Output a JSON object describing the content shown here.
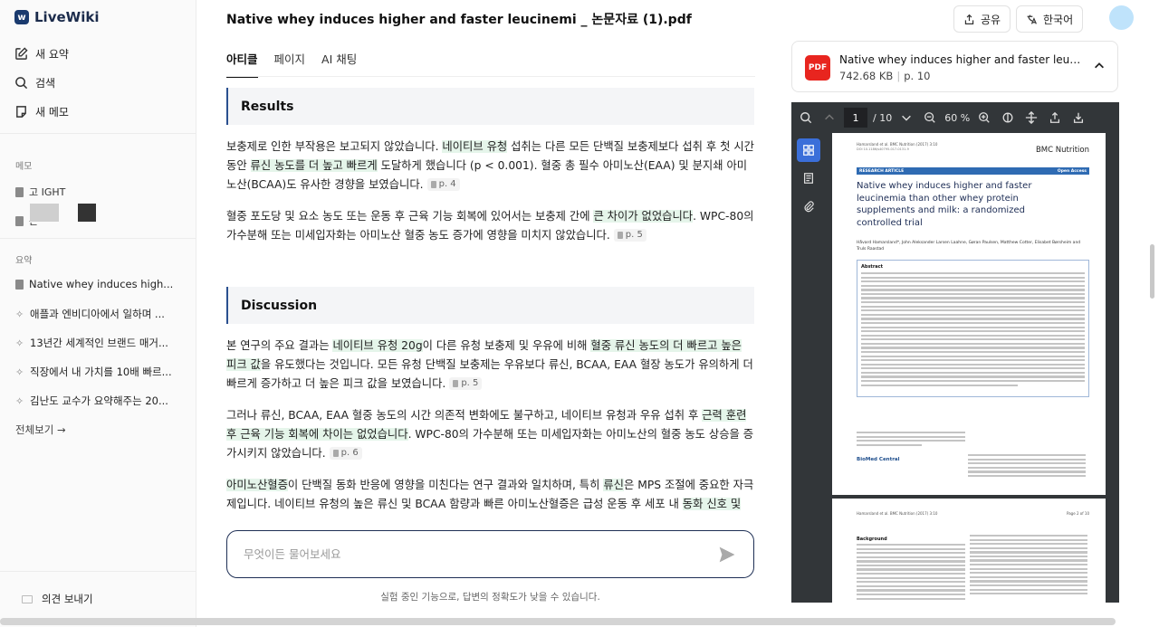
{
  "app": {
    "name": "LiveWiki"
  },
  "sidebar": {
    "nav": [
      {
        "label": "새 요약"
      },
      {
        "label": "검색"
      },
      {
        "label": "새 메모"
      }
    ],
    "memo_section": "메모",
    "memos": [
      {
        "label": "고                    IGHT"
      },
      {
        "label": "는"
      }
    ],
    "summary_section": "요약",
    "summaries": [
      {
        "label": "Native whey induces high..."
      },
      {
        "label": "애플과 엔비디아에서 일하며 ..."
      },
      {
        "label": "13년간 세계적인 브랜드 매거..."
      },
      {
        "label": "직장에서 내 가치를 10배 빠르..."
      },
      {
        "label": "김난도 교수가 요약해주는 20..."
      }
    ],
    "view_all": "전체보기 →",
    "feedback": "의견 보내기"
  },
  "main": {
    "title": "Native whey induces higher and faster leucinemi _ 논문자료 (1).pdf",
    "tabs": [
      {
        "label": "아티클",
        "active": true
      },
      {
        "label": "페이지"
      },
      {
        "label": "AI 채팅"
      }
    ],
    "sections": [
      {
        "heading": "Results",
        "paragraphs": [
          {
            "parts": [
              {
                "t": "보충제로 인한 부작용은 보고되지 않았습니다. "
              },
              {
                "t": "네이티브 유청",
                "hl": true
              },
              {
                "t": " 섭취는 다른 모든 단백질 보충제보다 섭취 후 첫 시간 동안 "
              },
              {
                "t": "류신 농도를 더 높고 빠르게",
                "hl": true
              },
              {
                "t": " 도달하게 했습니다 (p < 0.001). 혈중 총 필수 아미노산(EAA) 및 분지쇄 아미노산(BCAA)도 유사한 경향을 보였습니다."
              }
            ],
            "page": "p. 4"
          },
          {
            "parts": [
              {
                "t": "혈중 포도당 및 요소 농도 또는 운동 후 근육 기능 회복에 있어서는 보충제 간에 "
              },
              {
                "t": "큰 차이가 없었습니다",
                "hl": true
              },
              {
                "t": ". WPC-80의 가수분해 또는 미세입자화는 아미노산 혈중 농도 증가에 영향을 미치지 않았습니다."
              }
            ],
            "page": "p. 5"
          }
        ]
      },
      {
        "heading": "Discussion",
        "paragraphs": [
          {
            "parts": [
              {
                "t": "본 연구의 주요 결과는 "
              },
              {
                "t": "네이티브 유청 20g",
                "hl": true
              },
              {
                "t": "이 다른 유청 보충제 및 우유에 비해 "
              },
              {
                "t": "혈중 류신 농도의 더 빠르고 높은 피크 값",
                "hl": true
              },
              {
                "t": "을 유도했다는 것입니다. 모든 유청 단백질 보충제는 우유보다 류신, BCAA, EAA 혈장 농도가 유의하게 더 빠르게 증가하고 더 높은 피크 값을 보였습니다."
              }
            ],
            "page": "p. 5"
          },
          {
            "parts": [
              {
                "t": "그러나 류신, BCAA, EAA 혈중 농도의 시간 의존적 변화에도 불구하고, 네이티브 유청과 우유 섭취 후 "
              },
              {
                "t": "근력 훈련 후 근육 기능 회복에 차이는 없었습니다",
                "hl": true
              },
              {
                "t": ". WPC-80의 가수분해 또는 미세입자화는 아미노산의 혈중 농도 상승을 증가시키지 않았습니다."
              }
            ],
            "page": "p. 6"
          },
          {
            "parts": [
              {
                "t": "아미노산혈증",
                "hl": true
              },
              {
                "t": "이 단백질 동화 반응에 영향을 미친다는 연구 결과와 일치하며, 특히 "
              },
              {
                "t": "류신",
                "hl": true
              },
              {
                "t": "은 MPS 조절에 중요한 자극제입니다. 네이티브 유청의 높은 류신 및 BCAA 함량과 빠른 아미노산혈증은 급성 운동 후 세포 내 "
              },
              {
                "t": "동화 신호 및",
                "hl": true
              }
            ],
            "page": ""
          }
        ]
      }
    ],
    "chat_placeholder": "무엇이든 물어보세요",
    "disclaimer": "실험 중인 기능으로, 답변의 정확도가 낮을 수 있습니다."
  },
  "header": {
    "share": "공유",
    "language": "한국어"
  },
  "pdf": {
    "badge": "PDF",
    "name": "Native whey induces higher and faster leucinemi _ 논문자료 (1).pdf",
    "size": "742.68 KB",
    "pages": "p. 10",
    "viewer": {
      "page_input": "1",
      "page_total": "/ 10",
      "zoom": "60 %",
      "page1": {
        "header": "Hamarsland et al. BMC Nutrition (2017) 3:10",
        "doi": "DOI 10.1186/s40795-017-0131-9",
        "journal": "BMC Nutrition",
        "research_article": "RESEARCH ARTICLE",
        "open_access": "Open Access",
        "title": "Native whey induces higher and faster leucinemia than other whey protein supplements and milk: a randomized controlled trial",
        "authors": "Håvard Hamarsland*, John Aleksander Larsen Laahne, Gøran Paulsen, Matthew Cotter, Elisabet Børsheim and Truls Raastad",
        "abstract_heading": "Abstract",
        "publisher": "BioMed Central"
      },
      "page2": {
        "header": "Hamarsland et al. BMC Nutrition (2017) 3:10",
        "page": "Page 2 of 10",
        "background": "Background"
      }
    }
  },
  "colors": {
    "highlight": "#e5f5ea",
    "accent": "#2a4f8f",
    "pdf_red": "#e8251f",
    "viewer_bg": "#323639"
  }
}
